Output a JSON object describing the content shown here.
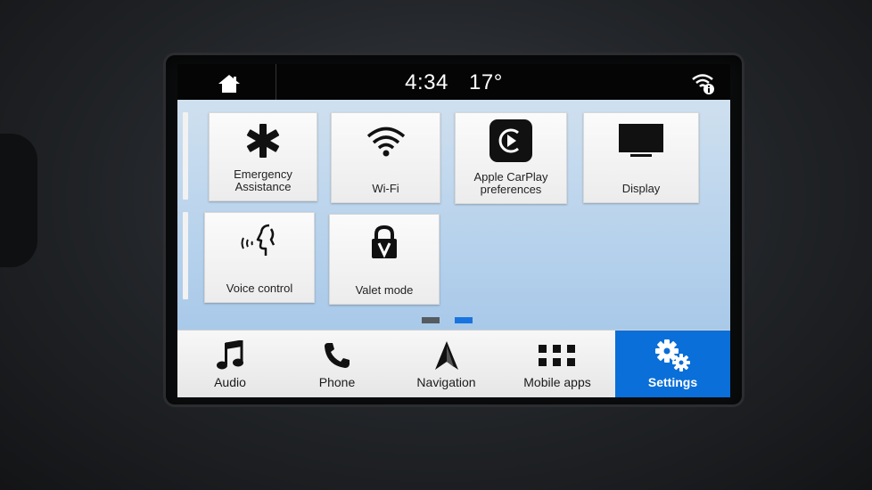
{
  "status_bar": {
    "time": "4:34",
    "temperature": "17°",
    "home_icon": "home-icon",
    "wifi_status_icon": "wifi-info-icon"
  },
  "settings_tiles": [
    {
      "label": "Emergency\nAssistance",
      "icon": "asterisk-icon"
    },
    {
      "label": "Wi-Fi",
      "icon": "wifi-icon"
    },
    {
      "label": "Apple CarPlay\npreferences",
      "icon": "carplay-icon"
    },
    {
      "label": "Display",
      "icon": "monitor-icon"
    },
    {
      "label": "Voice control",
      "icon": "voice-icon"
    },
    {
      "label": "Valet mode",
      "icon": "padlock-v-icon"
    }
  ],
  "pagination": {
    "pages": 2,
    "current": 2
  },
  "nav": [
    {
      "label": "Audio",
      "icon": "music-note-icon",
      "active": false
    },
    {
      "label": "Phone",
      "icon": "phone-icon",
      "active": false
    },
    {
      "label": "Navigation",
      "icon": "navigation-arrow-icon",
      "active": false
    },
    {
      "label": "Mobile apps",
      "icon": "grid-icon",
      "active": false
    },
    {
      "label": "Settings",
      "icon": "gears-icon",
      "active": true
    }
  ],
  "colors": {
    "accent": "#0a6fd8",
    "page_dot_inactive": "#555b60",
    "page_dot_active": "#1a74e0"
  }
}
